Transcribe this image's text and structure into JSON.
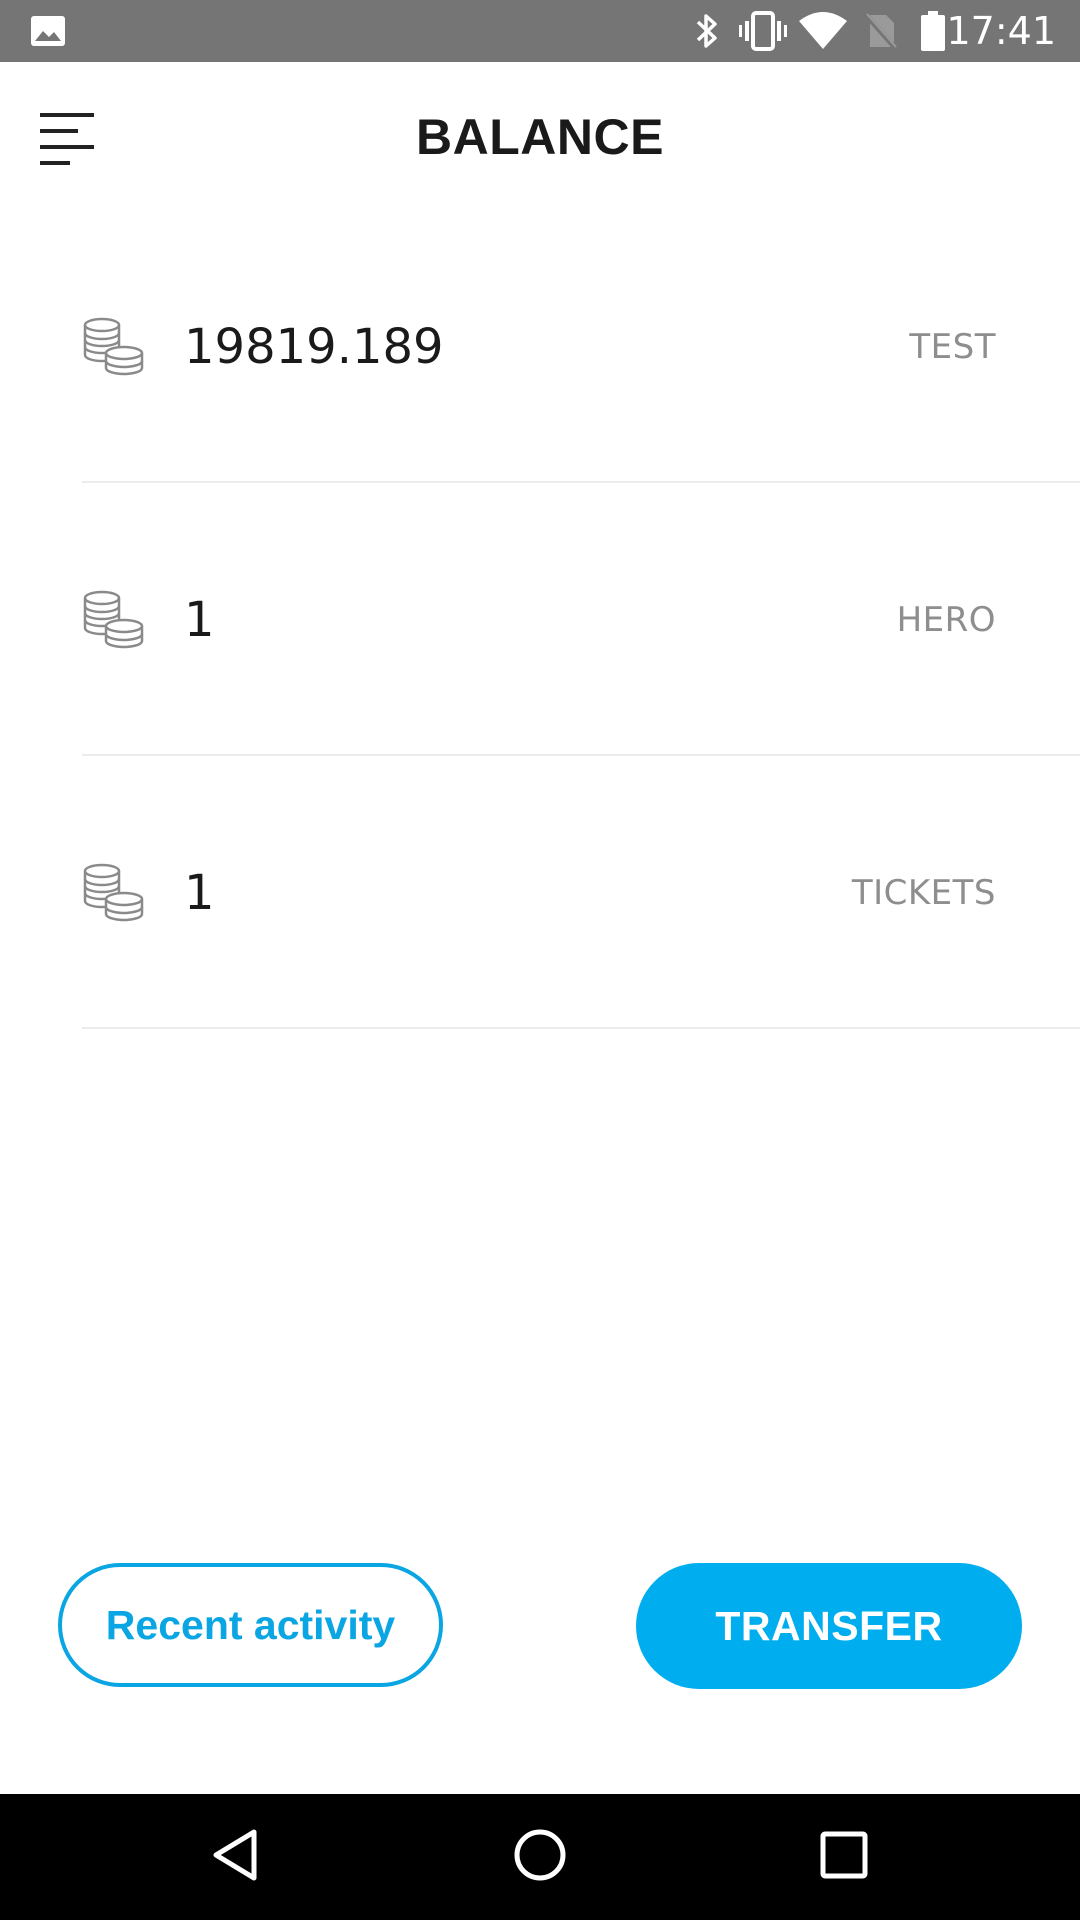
{
  "status_bar": {
    "time": "17:41",
    "icons": [
      "image-notification-icon",
      "bluetooth-icon",
      "vibrate-icon",
      "wifi-icon",
      "no-sim-icon",
      "battery-icon"
    ]
  },
  "header": {
    "title": "BALANCE",
    "menu_icon": "menu-icon"
  },
  "balances": [
    {
      "amount": "19819.189",
      "currency": "TEST",
      "icon": "coins-icon"
    },
    {
      "amount": "1",
      "currency": "HERO",
      "icon": "coins-icon"
    },
    {
      "amount": "1",
      "currency": "TICKETS",
      "icon": "coins-icon"
    }
  ],
  "actions": {
    "recent_activity_label": "Recent activity",
    "transfer_label": "TRANSFER"
  },
  "nav_bar": {
    "icons": [
      "back-icon",
      "home-icon",
      "recents-icon"
    ]
  },
  "colors": {
    "accent": "#00aeef",
    "status_bar": "#757575",
    "nav_bar": "#000000",
    "divider": "#ececec"
  }
}
